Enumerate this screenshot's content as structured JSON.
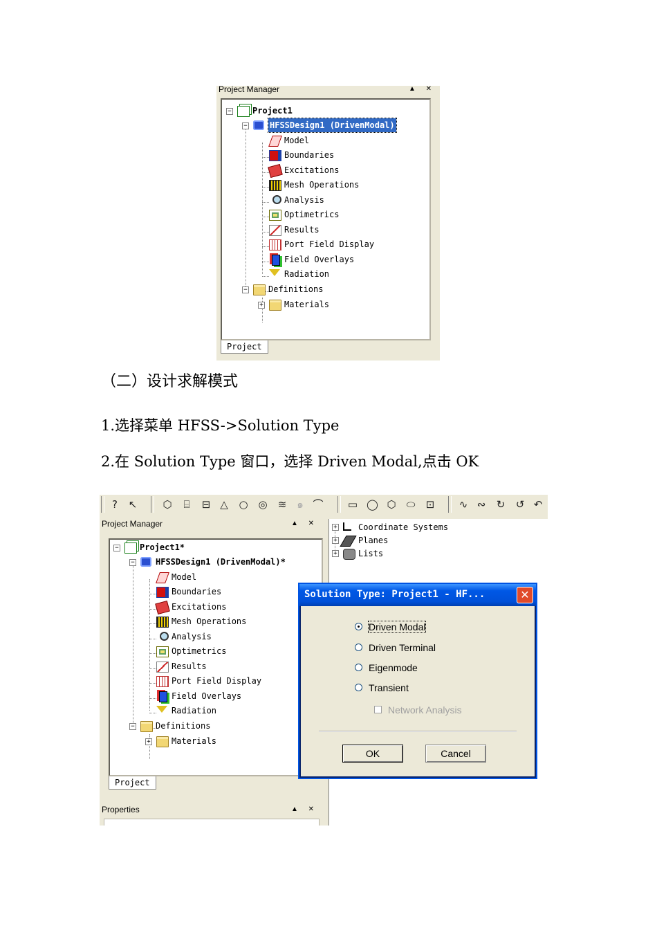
{
  "top_panel": {
    "title": "Project Manager",
    "controls": "▲ ✕",
    "tab": "Project",
    "tree": {
      "project": "Project1",
      "design": "HFSSDesign1 (DrivenModal)",
      "items": [
        "Model",
        "Boundaries",
        "Excitations",
        "Mesh Operations",
        "Analysis",
        "Optimetrics",
        "Results",
        "Port Field Display",
        "Field Overlays",
        "Radiation"
      ],
      "definitions": "Definitions",
      "materials": "Materials"
    }
  },
  "text": {
    "section_heading": "（二）设计求解模式",
    "step1": "1.选择菜单 HFSS->Solution Type",
    "step2": "2.在 Solution Type 窗口，选择 Driven Modal,点击 OK"
  },
  "bottom_panel": {
    "title": "Project Manager",
    "controls": "▲ ✕",
    "tab": "Project",
    "properties_title": "Properties",
    "properties_controls": "▲ ✕",
    "tree": {
      "project": "Project1*",
      "design": "HFSSDesign1 (DrivenModal)*",
      "items": [
        "Model",
        "Boundaries",
        "Excitations",
        "Mesh Operations",
        "Analysis",
        "Optimetrics",
        "Results",
        "Port Field Display",
        "Field Overlays",
        "Radiation"
      ],
      "definitions": "Definitions",
      "materials": "Materials"
    },
    "model_tree": [
      "Coordinate Systems",
      "Planes",
      "Lists"
    ]
  },
  "dialog": {
    "title": "Solution Type: Project1 - HF...",
    "close": "✕",
    "options": [
      "Driven Modal",
      "Driven Terminal",
      "Eigenmode",
      "Transient"
    ],
    "selected": "Driven Modal",
    "network_analysis": "Network Analysis",
    "ok": "OK",
    "cancel": "Cancel"
  }
}
